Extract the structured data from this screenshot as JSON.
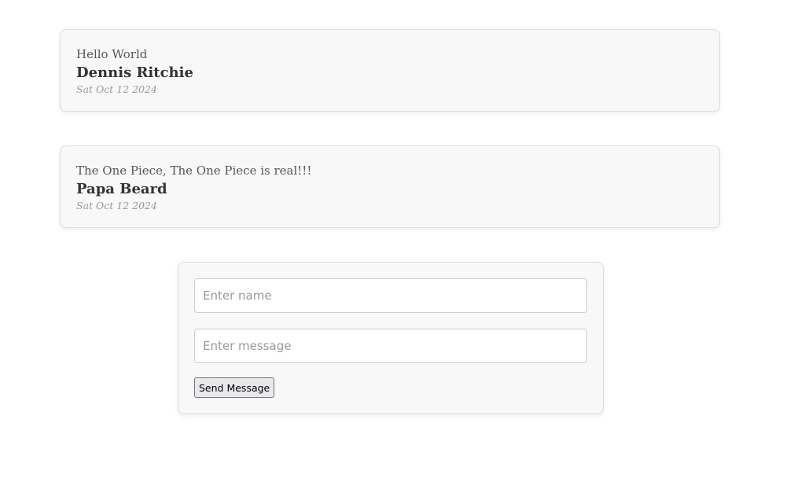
{
  "messages": [
    {
      "text": "Hello World",
      "author": "Dennis Ritchie",
      "date": "Sat Oct 12 2024"
    },
    {
      "text": "The One Piece, The One Piece is real!!!",
      "author": "Papa Beard",
      "date": "Sat Oct 12 2024"
    }
  ],
  "form": {
    "name_placeholder": "Enter name",
    "message_placeholder": "Enter message",
    "submit_label": "Send Message"
  }
}
